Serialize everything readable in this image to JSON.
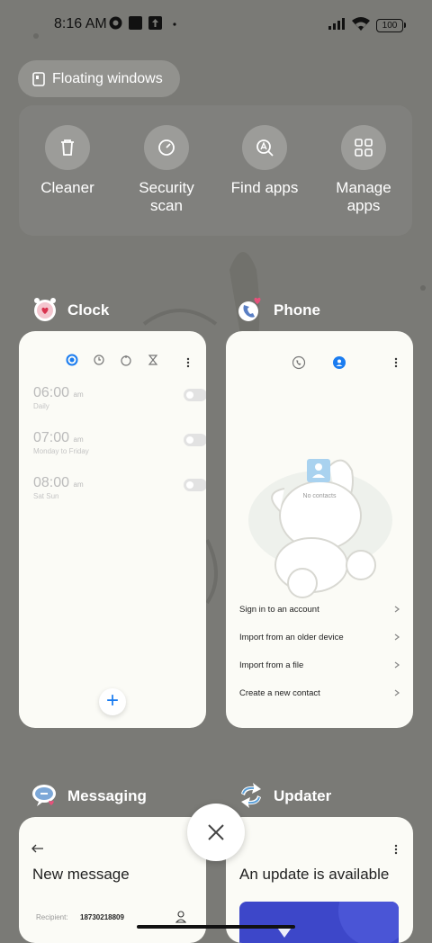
{
  "status_bar": {
    "time": "8:16 AM",
    "battery": "100"
  },
  "floating_windows": {
    "label": "Floating windows"
  },
  "tools": [
    {
      "label": "Cleaner",
      "icon": "trash-icon"
    },
    {
      "label": "Security scan",
      "icon": "gauge-icon"
    },
    {
      "label": "Find apps",
      "icon": "search-a-icon"
    },
    {
      "label": "Manage apps",
      "icon": "grid-icon"
    }
  ],
  "clock": {
    "app_name": "Clock",
    "alarms": [
      {
        "time": "06:00",
        "ampm": "am",
        "repeat": "Daily"
      },
      {
        "time": "07:00",
        "ampm": "am",
        "repeat": "Monday to Friday"
      },
      {
        "time": "08:00",
        "ampm": "am",
        "repeat": "Sat Sun"
      }
    ],
    "add_label": "+"
  },
  "phone": {
    "app_name": "Phone",
    "empty_text": "No contacts",
    "options": [
      "Sign in to an account",
      "Import from an older device",
      "Import from a file",
      "Create a new contact"
    ]
  },
  "messaging": {
    "app_name": "Messaging",
    "title": "New message",
    "recipient_label": "Recipient:",
    "recipient_value": "18730218809"
  },
  "updater": {
    "app_name": "Updater",
    "title": "An update is available"
  },
  "colors": {
    "accent": "#1a7cf0",
    "scrim": "#7a7a76",
    "card": "#fbfbf6",
    "updater_banner": "#3d47c9"
  }
}
